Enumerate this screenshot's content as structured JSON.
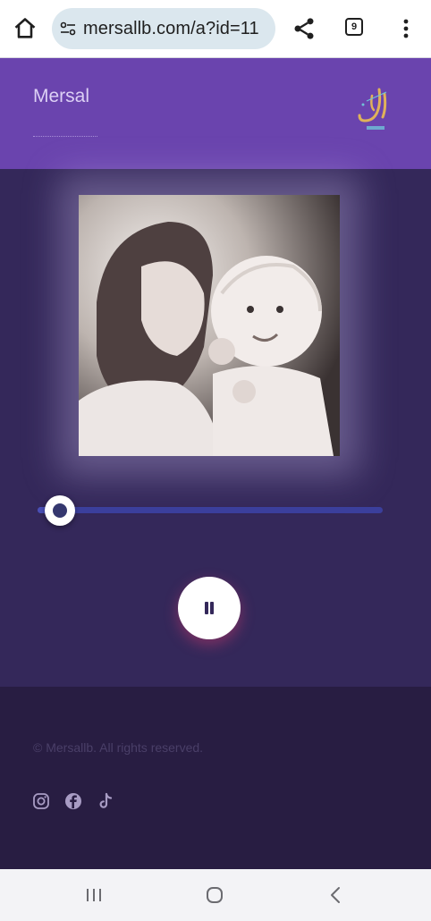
{
  "browser": {
    "url": "mersallb.com/a?id=11",
    "tab_count": "9"
  },
  "header": {
    "site_title": "Mersal",
    "logo_icon": "mersal-calligraphy-logo",
    "logo_colors": [
      "#e0b25a",
      "#6fc3d8"
    ]
  },
  "player": {
    "artwork_icon": "mother-and-baby-photo",
    "progress_fraction": 0.07,
    "state": "playing",
    "pause_icon": "pause-icon"
  },
  "footer": {
    "copyright": "© Mersallb. All rights reserved.",
    "social": [
      "instagram-icon",
      "facebook-icon",
      "tiktok-icon"
    ]
  },
  "colors": {
    "header_bg": "#6a44ae",
    "player_bg": "#34285a",
    "footer_bg": "#281d42",
    "track": "#3b3f9c"
  }
}
